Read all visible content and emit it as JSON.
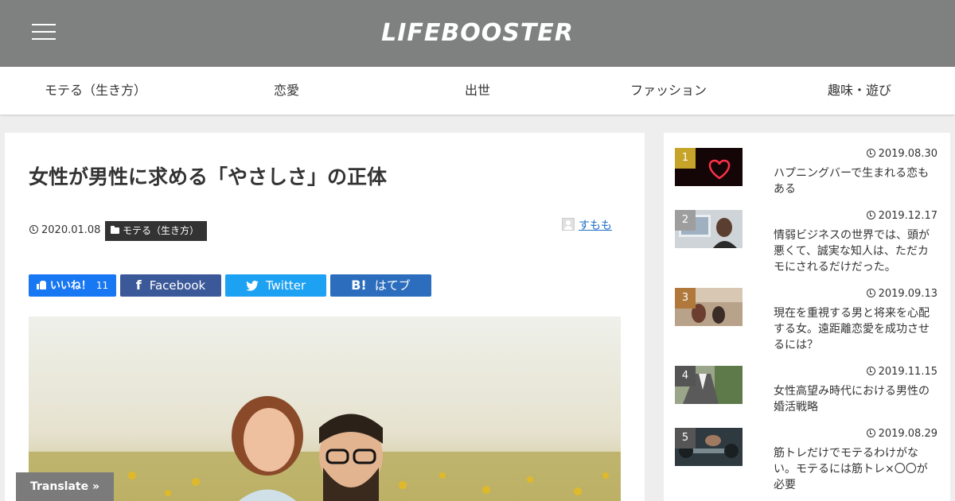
{
  "header": {
    "logo": "LIFEBOOSTER",
    "bg_color": "#7f8080"
  },
  "nav": {
    "items": [
      {
        "label": "モテる（生き方）"
      },
      {
        "label": "恋愛"
      },
      {
        "label": "出世"
      },
      {
        "label": "ファッション"
      },
      {
        "label": "趣味・遊び"
      }
    ]
  },
  "article": {
    "title": "女性が男性に求める「やさしさ」の正体",
    "date": "2020.01.08",
    "category": "モテる（生き方）",
    "author": "すもも"
  },
  "share": {
    "like_label": "いいね！",
    "like_count": "11",
    "facebook_label": "Facebook",
    "twitter_label": "Twitter",
    "hatena_icon": "B!",
    "hatena_label": "はてブ",
    "colors": {
      "like": "#1877f2",
      "facebook": "#3b5998",
      "twitter": "#1da1f2",
      "hatena": "#2c6ebd"
    }
  },
  "ranking": [
    {
      "num": "1",
      "date": "2019.08.30",
      "title": "ハプニングバーで生まれる恋もある",
      "badge_color": "#c6a329"
    },
    {
      "num": "2",
      "date": "2019.12.17",
      "title": "情弱ビジネスの世界では、頭が悪くて、誠実な知人は、ただカモにされるだけだった。",
      "badge_color": "#9e9e9e"
    },
    {
      "num": "3",
      "date": "2019.09.13",
      "title": "現在を重視する男と将来を心配する女。遠距離恋愛を成功させるには？",
      "badge_color": "#b0783a"
    },
    {
      "num": "4",
      "date": "2019.11.15",
      "title": "女性高望み時代における男性の婚活戦略",
      "badge_color": "#555555"
    },
    {
      "num": "5",
      "date": "2019.08.29",
      "title": "筋トレだけでモテるわけがない。モテるには筋トレ×〇〇が必要",
      "badge_color": "#555555"
    }
  ],
  "translate": {
    "label": "Translate »"
  }
}
